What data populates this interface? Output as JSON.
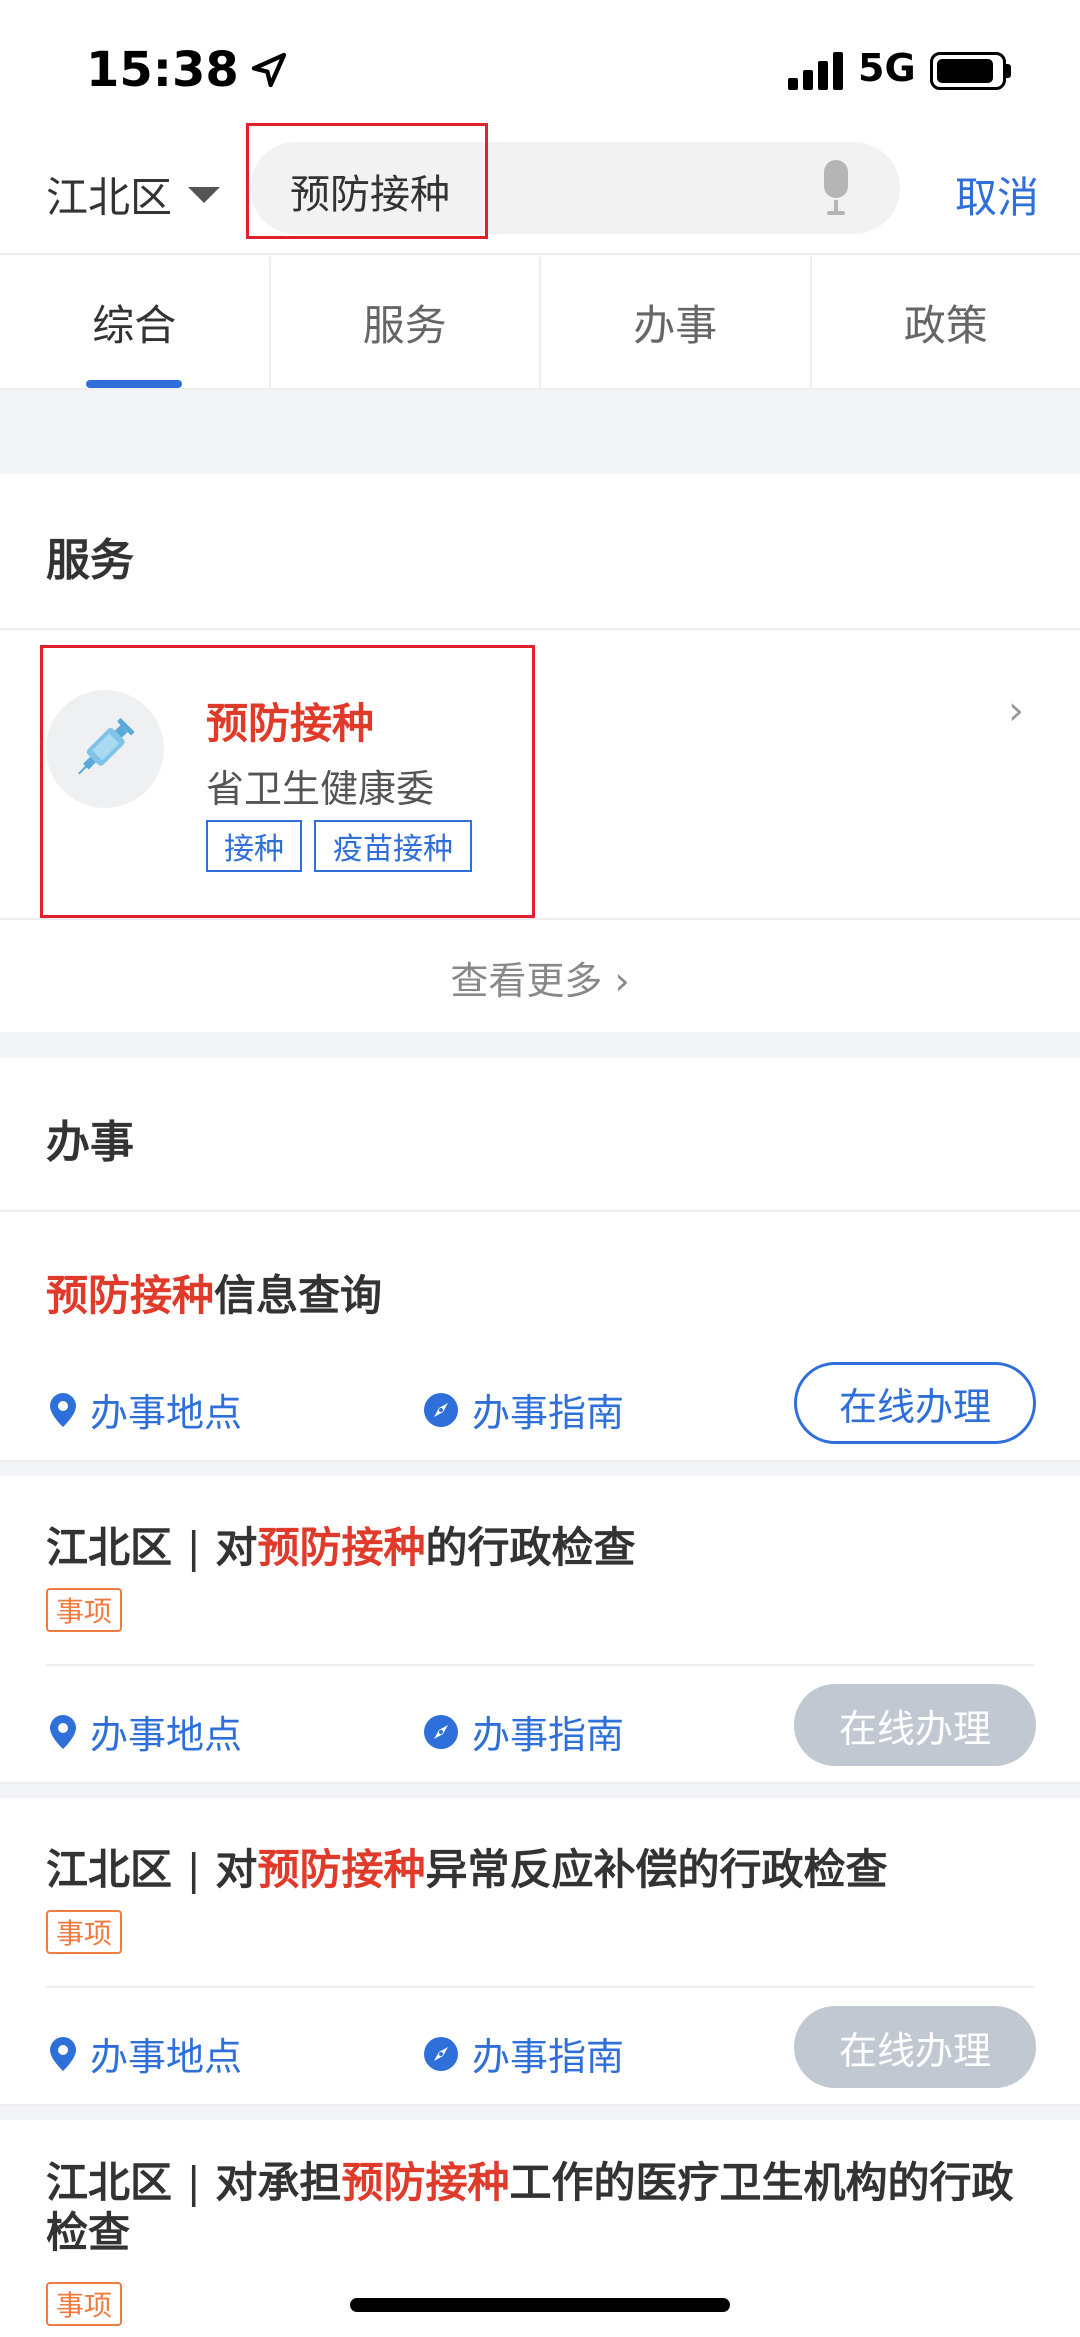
{
  "status_bar": {
    "time": "15:38",
    "network": "5G"
  },
  "header": {
    "region": "江北区",
    "search_value": "预防接种",
    "cancel_label": "取消"
  },
  "tabs": [
    "综合",
    "服务",
    "办事",
    "政策"
  ],
  "services_section": {
    "title": "服务",
    "card": {
      "name": "预防接种",
      "department": "省卫生健康委",
      "tags": [
        "接种",
        "疫苗接种"
      ]
    },
    "more_label": "查看更多 ›"
  },
  "handling_section": {
    "title": "办事",
    "action_location": "办事地点",
    "action_guide": "办事指南",
    "online_label": "在线办理",
    "badge_label": "事项",
    "items": [
      {
        "prefix": "",
        "highlight": "预防接种",
        "suffix": "信息查询"
      },
      {
        "region": "江北区",
        "separator": "|",
        "prefix": "对",
        "highlight": "预防接种",
        "suffix": "的行政检查"
      },
      {
        "region": "江北区",
        "separator": "|",
        "prefix": "对",
        "highlight": "预防接种",
        "suffix": "异常反应补偿的行政检查"
      },
      {
        "region": "江北区",
        "separator": "|",
        "prefix": "对承担",
        "highlight": "预防接种",
        "suffix": "工作的医疗卫生机构的行政检查"
      }
    ]
  },
  "colors": {
    "accent": "#2f6fd9",
    "highlight": "#e03a2b",
    "badge": "#f07b3f",
    "disabled": "#c2c8d1"
  }
}
